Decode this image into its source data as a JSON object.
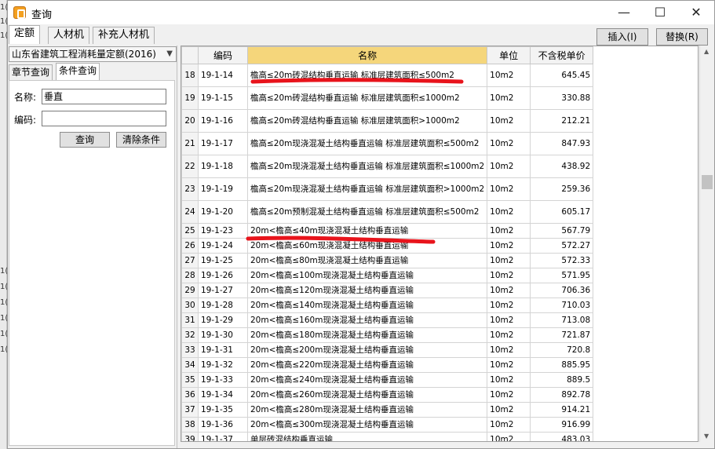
{
  "window": {
    "title": "查询"
  },
  "window_controls": {
    "minimize": "—",
    "maximize": "☐",
    "close": "✕"
  },
  "background_strip": [
    "1(",
    "1(",
    "1(",
    "1(",
    "1(",
    "1(",
    "1(",
    "1(",
    "1("
  ],
  "tabs": [
    {
      "label": "定额",
      "active": true
    },
    {
      "label": "人材机",
      "active": false
    },
    {
      "label": "补充人材机",
      "active": false
    }
  ],
  "toolbar": {
    "insert_label": "插入(I)",
    "replace_label": "替换(R)"
  },
  "left_panel": {
    "quota_library": "山东省建筑工程消耗量定额(2016)",
    "subtabs": [
      {
        "label": "章节查询",
        "active": false
      },
      {
        "label": "条件查询",
        "active": true
      }
    ],
    "name_label": "名称:",
    "name_value": "垂直",
    "code_label": "编码:",
    "code_value": "",
    "search_button": "查询",
    "clear_button": "清除条件"
  },
  "grid": {
    "headers": {
      "index": "",
      "code": "编码",
      "name": "名称",
      "unit": "单位",
      "price": "不含税单价"
    },
    "rows": [
      {
        "idx": "18",
        "code": "19-1-14",
        "name": "檐高≤20m砖混结构垂直运输 标准层建筑面积≤500m2",
        "unit": "10m2",
        "price": "645.45",
        "tall": true
      },
      {
        "idx": "19",
        "code": "19-1-15",
        "name": "檐高≤20m砖混结构垂直运输 标准层建筑面积≤1000m2",
        "unit": "10m2",
        "price": "330.88",
        "tall": true
      },
      {
        "idx": "20",
        "code": "19-1-16",
        "name": "檐高≤20m砖混结构垂直运输 标准层建筑面积>1000m2",
        "unit": "10m2",
        "price": "212.21",
        "tall": true
      },
      {
        "idx": "21",
        "code": "19-1-17",
        "name": "檐高≤20m现浇混凝土结构垂直运输 标准层建筑面积≤500m2",
        "unit": "10m2",
        "price": "847.93",
        "tall": true
      },
      {
        "idx": "22",
        "code": "19-1-18",
        "name": "檐高≤20m现浇混凝土结构垂直运输 标准层建筑面积≤1000m2",
        "unit": "10m2",
        "price": "438.92",
        "tall": true
      },
      {
        "idx": "23",
        "code": "19-1-19",
        "name": "檐高≤20m现浇混凝土结构垂直运输 标准层建筑面积>1000m2",
        "unit": "10m2",
        "price": "259.36",
        "tall": true
      },
      {
        "idx": "24",
        "code": "19-1-20",
        "name": "檐高≤20m预制混凝土结构垂直运输 标准层建筑面积≤500m2",
        "unit": "10m2",
        "price": "605.17",
        "tall": true
      },
      {
        "idx": "25",
        "code": "19-1-23",
        "name": "20m<檐高≤40m现浇混凝土结构垂直运输",
        "unit": "10m2",
        "price": "567.79",
        "tall": false
      },
      {
        "idx": "26",
        "code": "19-1-24",
        "name": "20m<檐高≤60m现浇混凝土结构垂直运输",
        "unit": "10m2",
        "price": "572.27",
        "tall": false
      },
      {
        "idx": "27",
        "code": "19-1-25",
        "name": "20m<檐高≤80m现浇混凝土结构垂直运输",
        "unit": "10m2",
        "price": "572.33",
        "tall": false
      },
      {
        "idx": "28",
        "code": "19-1-26",
        "name": "20m<檐高≤100m现浇混凝土结构垂直运输",
        "unit": "10m2",
        "price": "571.95",
        "tall": false
      },
      {
        "idx": "29",
        "code": "19-1-27",
        "name": "20m<檐高≤120m现浇混凝土结构垂直运输",
        "unit": "10m2",
        "price": "706.36",
        "tall": false
      },
      {
        "idx": "30",
        "code": "19-1-28",
        "name": "20m<檐高≤140m现浇混凝土结构垂直运输",
        "unit": "10m2",
        "price": "710.03",
        "tall": false
      },
      {
        "idx": "31",
        "code": "19-1-29",
        "name": "20m<檐高≤160m现浇混凝土结构垂直运输",
        "unit": "10m2",
        "price": "713.08",
        "tall": false
      },
      {
        "idx": "32",
        "code": "19-1-30",
        "name": "20m<檐高≤180m现浇混凝土结构垂直运输",
        "unit": "10m2",
        "price": "721.87",
        "tall": false
      },
      {
        "idx": "33",
        "code": "19-1-31",
        "name": "20m<檐高≤200m现浇混凝土结构垂直运输",
        "unit": "10m2",
        "price": "720.8",
        "tall": false
      },
      {
        "idx": "34",
        "code": "19-1-32",
        "name": "20m<檐高≤220m现浇混凝土结构垂直运输",
        "unit": "10m2",
        "price": "885.95",
        "tall": false
      },
      {
        "idx": "35",
        "code": "19-1-33",
        "name": "20m<檐高≤240m现浇混凝土结构垂直运输",
        "unit": "10m2",
        "price": "889.5",
        "tall": false
      },
      {
        "idx": "36",
        "code": "19-1-34",
        "name": "20m<檐高≤260m现浇混凝土结构垂直运输",
        "unit": "10m2",
        "price": "892.78",
        "tall": false
      },
      {
        "idx": "37",
        "code": "19-1-35",
        "name": "20m<檐高≤280m现浇混凝土结构垂直运输",
        "unit": "10m2",
        "price": "914.21",
        "tall": false
      },
      {
        "idx": "38",
        "code": "19-1-36",
        "name": "20m<檐高≤300m现浇混凝土结构垂直运输",
        "unit": "10m2",
        "price": "916.99",
        "tall": false
      },
      {
        "idx": "39",
        "code": "19-1-37",
        "name": "单层砖混结构垂直运输",
        "unit": "10m2",
        "price": "483.03",
        "tall": false
      }
    ]
  },
  "colors": {
    "name_header": "#f5d67b",
    "annotation_red": "#e8141c"
  }
}
